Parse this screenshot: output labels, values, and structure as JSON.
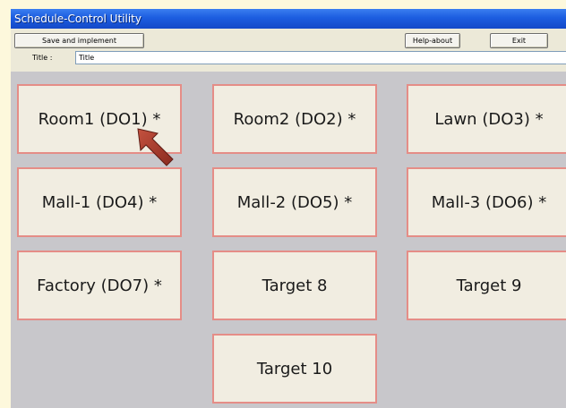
{
  "window": {
    "title": "Schedule-Control Utility"
  },
  "toolbar": {
    "save_label": "Save and implement",
    "help_label": "Help-about",
    "exit_label": "Exit",
    "title_label": "Title :",
    "title_value": "Title"
  },
  "targets": [
    {
      "label": "Room1 (DO1) *"
    },
    {
      "label": "Room2 (DO2) *"
    },
    {
      "label": "Lawn (DO3) *"
    },
    {
      "label": "Mall-1 (DO4) *"
    },
    {
      "label": "Mall-2 (DO5) *"
    },
    {
      "label": "Mall-3 (DO6) *"
    },
    {
      "label": "Factory (DO7) *"
    },
    {
      "label": "Target 8"
    },
    {
      "label": "Target 9"
    },
    {
      "label": "Target 10"
    }
  ],
  "colors": {
    "titlebar": "#1c5de0",
    "target_border": "#e58d87",
    "target_fill": "#f1ede1",
    "arrow": "#a83a2c"
  },
  "icons": {
    "pointer": "arrow-pointer-icon"
  }
}
